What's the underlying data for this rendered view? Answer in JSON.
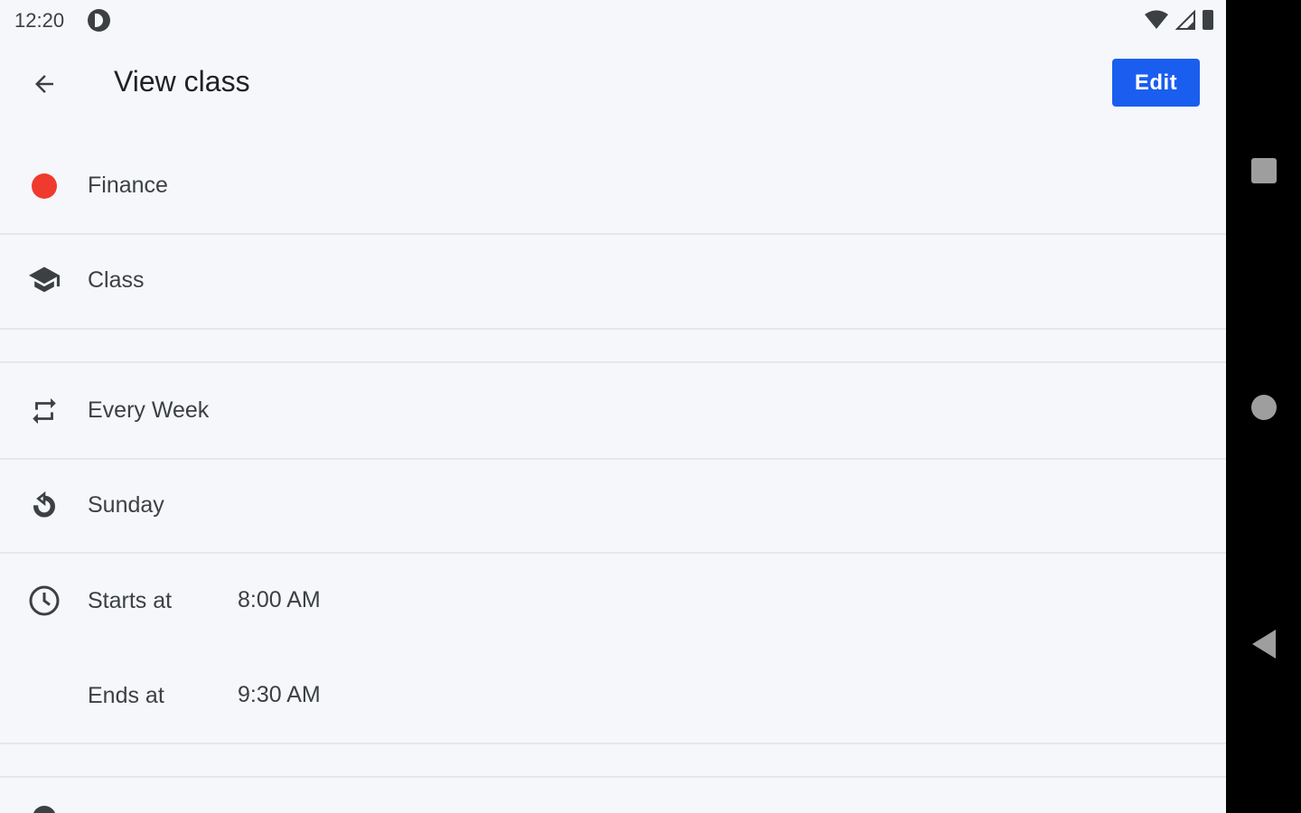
{
  "status_bar": {
    "time": "12:20"
  },
  "toolbar": {
    "title": "View class",
    "edit_label": "Edit"
  },
  "details": {
    "subject": "Finance",
    "subject_color": "#f03a2e",
    "type": "Class",
    "repeat": "Every Week",
    "day": "Sunday",
    "starts_label": "Starts at",
    "starts_value": "8:00 AM",
    "ends_label": "Ends at",
    "ends_value": "9:30 AM"
  },
  "colors": {
    "accent": "#1a5ef0",
    "background": "#f6f7fb",
    "nav_bar": "#000000"
  }
}
